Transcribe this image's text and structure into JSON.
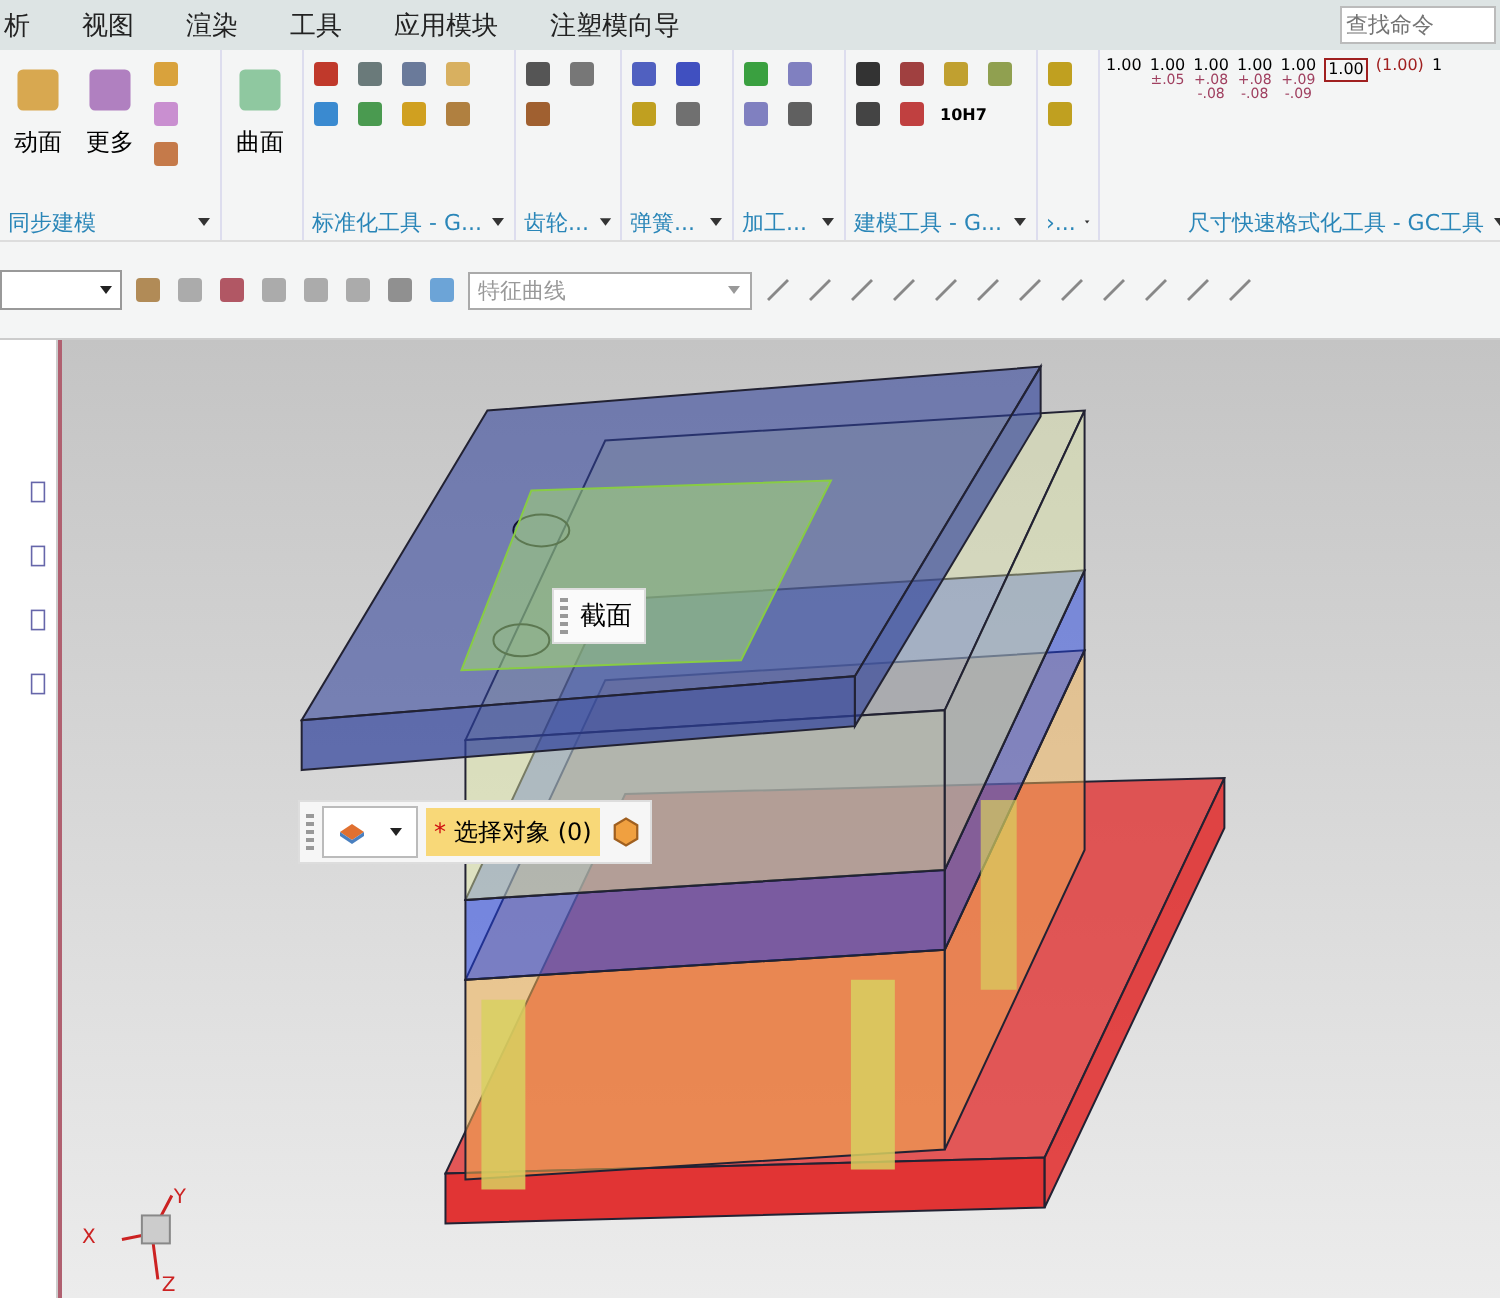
{
  "menu": [
    "析",
    "视图",
    "渲染",
    "工具",
    "应用模块",
    "注塑模向导"
  ],
  "search": {
    "placeholder": "查找命令"
  },
  "ribbon_groups": [
    {
      "label": "同步建模",
      "buttons": [
        "动面",
        "更多"
      ]
    },
    {
      "buttons": [
        "曲面"
      ]
    },
    {
      "label": "标准化工具 - G..."
    },
    {
      "label": "齿轮..."
    },
    {
      "label": "弹簧..."
    },
    {
      "label": "加工..."
    },
    {
      "label": "建模工具 - G...",
      "icon_text": "10H7"
    },
    {
      "label": "›..."
    },
    {
      "label": "尺寸快速格式化工具 - GC工具",
      "dimension_styles": [
        {
          "kind": "plain",
          "value": "1.00"
        },
        {
          "kind": "tolerance",
          "value": "1.00",
          "tolerance": [
            "±.05"
          ]
        },
        {
          "kind": "tolerance",
          "value": "1.00",
          "tolerance": [
            "+.08",
            "-.08"
          ]
        },
        {
          "kind": "tolerance",
          "value": "1.00",
          "tolerance": [
            "+.08",
            "-.08"
          ]
        },
        {
          "kind": "tolerance",
          "value": "1.00",
          "tolerance": [
            "+.09",
            "-.09"
          ]
        },
        {
          "kind": "boxed",
          "value": "1.00"
        },
        {
          "kind": "reference",
          "value": "(1.00)"
        },
        {
          "kind": "plain",
          "value": "1"
        }
      ]
    }
  ],
  "toolbar": {
    "filter": {
      "value": "特征曲线"
    }
  },
  "viewport": {
    "section_label": "截面",
    "selection_bar": {
      "required_mark": "*",
      "label": "选择对象 (0)"
    },
    "axes": [
      "X",
      "Y",
      "Z"
    ]
  }
}
